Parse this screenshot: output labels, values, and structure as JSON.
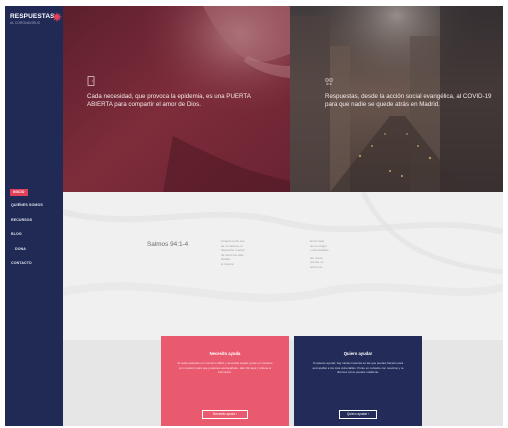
{
  "brand": {
    "name": "RESPUESTAS",
    "tagline": "AL CORONAVIRUS"
  },
  "nav": {
    "items": [
      {
        "label": "INICIO",
        "active": true
      },
      {
        "label": "QUIÉNES SOMOS",
        "active": false
      },
      {
        "label": "RECURSOS",
        "active": false
      },
      {
        "label": "BLOG",
        "active": false
      },
      {
        "label": "DONA",
        "active": false
      },
      {
        "label": "CONTACTO",
        "active": false
      }
    ]
  },
  "hero": {
    "left_text": "Cada necesidad, que provoca la epidemia, es una PUERTA ABIERTA para compartir el amor de Dios.",
    "right_text": "Respuestas, desde la acción social evangélica, al COVID-19 para que nadie se quede atrás en Madrid."
  },
  "verse": {
    "reference": "Salmos 94:1-4",
    "col1": [
      "Cuando tenía ese",
      "de mi cabeza, tu",
      "dependía: nuestro",
      "de todos los días",
      "flotaba",
      "la trampa"
    ],
    "col2": [
      "En la casa, ",
      "de tu refugio",
      "y acompáñale",
      "del nuevo",
      "pondré mi",
      "sobre los"
    ]
  },
  "cards": {
    "need": {
      "title": "Necesito ayuda",
      "description": "Si estás pasando un momento difícil y necesitas ayuda, ponte en contacto con nosotros para que podamos acompañarte. Haz clic aquí y rellena el formulario.",
      "button": "Necesito ayuda"
    },
    "help": {
      "title": "Quiero ayudar",
      "description": "Si quieres ayudar, hay varias maneras en las que puedes hacerlo para acompañar a los más vulnerables. Ponte en contacto con nosotros y te diremos cómo puedes colaborar.",
      "button": "Quiero ayudar"
    }
  },
  "colors": {
    "sidebar": "#202a55",
    "accent": "#e0405a",
    "card_need": "#ea5a6f",
    "card_help": "#232c59"
  }
}
